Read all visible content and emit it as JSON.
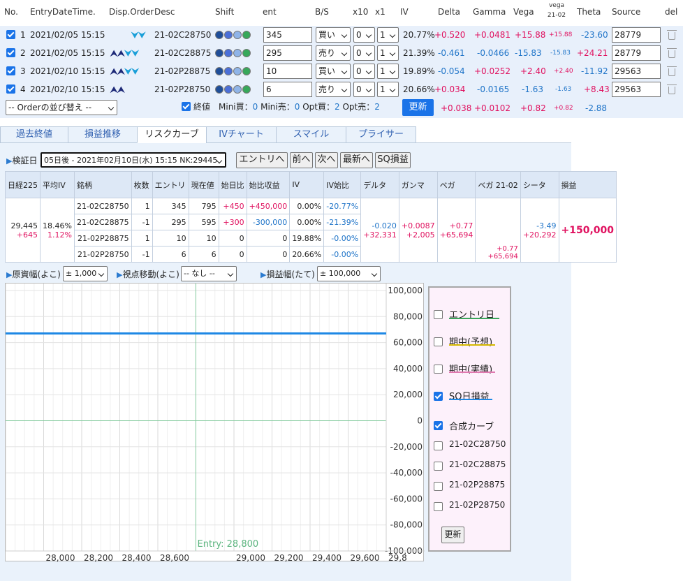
{
  "order_table": {
    "headers": {
      "no": "No.",
      "entry": "EntryDateTime.",
      "disp": "Disp.Order",
      "desc": "Desc",
      "shift": "Shift",
      "ent": "ent",
      "bs": "B/S",
      "x10": "x10",
      "x1": "x1",
      "iv": "IV",
      "delta": "Delta",
      "gamma": "Gamma",
      "vega": "Vega",
      "vega2_top": "vega",
      "vega2_bot": "21-02",
      "theta": "Theta",
      "source": "Source",
      "del": "del"
    },
    "rows": [
      {
        "no": "1",
        "datetime": "2021/02/05 15:15",
        "arrows": "⮟⮟",
        "desc": "21-02C28750",
        "ent": "345",
        "bs": "買い",
        "x10": "0",
        "x1": "1",
        "iv": "20.77%",
        "delta": "+0.520",
        "gamma": "+0.0481",
        "vega": "+15.88",
        "vega2": "+15.88",
        "theta": "-23.60",
        "source": "28779"
      },
      {
        "no": "2",
        "datetime": "2021/02/05 15:15",
        "arrows": "⮝⮝⮟⮟",
        "desc": "21-02C28875",
        "ent": "295",
        "bs": "売り",
        "x10": "0",
        "x1": "1",
        "iv": "21.39%",
        "delta": "-0.461",
        "gamma": "-0.0466",
        "vega": "-15.83",
        "vega2": "-15.83",
        "theta": "+24.21",
        "source": "28779"
      },
      {
        "no": "3",
        "datetime": "2021/02/10 15:15",
        "arrows": "⮝⮝⮟⮟",
        "desc": "21-02P28875",
        "ent": "10",
        "bs": "買い",
        "x10": "0",
        "x1": "1",
        "iv": "19.89%",
        "delta": "-0.054",
        "gamma": "+0.0252",
        "vega": "+2.40",
        "vega2": "+2.40",
        "theta": "-11.92",
        "source": "29563"
      },
      {
        "no": "4",
        "datetime": "2021/02/10 15:15",
        "arrows": "⮝⮝",
        "desc": "21-02P28750",
        "ent": "6",
        "bs": "売り",
        "x10": "0",
        "x1": "1",
        "iv": "20.66%",
        "delta": "+0.034",
        "gamma": "-0.0165",
        "vega": "-1.63",
        "vega2": "-1.63",
        "theta": "+8.43",
        "source": "29563"
      }
    ],
    "footer": {
      "sort_select": "-- Orderの並び替え --",
      "final_label": "終値",
      "mini_buy_label": "Mini買：",
      "mini_buy": "0",
      "mini_sell_label": "Mini売：",
      "mini_sell": "0",
      "opt_buy_label": "Opt買：",
      "opt_buy": "2",
      "opt_sell_label": "Opt売：",
      "opt_sell": "2",
      "update_button": "更新",
      "delta": "+0.038",
      "gamma": "+0.0102",
      "vega": "+0.82",
      "vega2": "+0.82",
      "theta": "-2.88"
    }
  },
  "tabs": [
    "過去終値",
    "損益推移",
    "リスクカーブ",
    "IVチャート",
    "スマイル",
    "プライサー"
  ],
  "active_tab": "リスクカーブ",
  "verify": {
    "label": "検証日",
    "date_select": "05日後 - 2021年02月10日(水) 15:15 NK:29445",
    "buttons": [
      "エントリへ",
      "前へ",
      "次へ",
      "最新へ",
      "SQ損益"
    ]
  },
  "risk_table": {
    "headers": [
      "日経225",
      "平均IV",
      "銘柄",
      "枚数",
      "エントリ",
      "現在値",
      "始日比",
      "始比収益",
      "IV",
      "IV始比",
      "デルタ",
      "ガンマ",
      "ベガ",
      "ベガ 21-02",
      "シータ",
      "損益"
    ],
    "nikkei": "29,445",
    "nikkei_chg": "+645",
    "avg_iv": "18.46%",
    "avg_iv_chg": "1.12%",
    "rows": [
      {
        "name": "21-02C28750",
        "qty": "1",
        "entry": "345",
        "cur": "795",
        "chg": "+450",
        "pl": "+450,000",
        "iv": "0.00%",
        "ivchg": "-20.77%"
      },
      {
        "name": "21-02C28875",
        "qty": "-1",
        "entry": "295",
        "cur": "595",
        "chg": "+300",
        "pl": "-300,000",
        "iv": "0.00%",
        "ivchg": "-21.39%"
      },
      {
        "name": "21-02P28875",
        "qty": "1",
        "entry": "10",
        "cur": "10",
        "chg": "0",
        "pl": "0",
        "iv": "19.88%",
        "ivchg": "-0.00%"
      },
      {
        "name": "21-02P28750",
        "qty": "-1",
        "entry": "6",
        "cur": "6",
        "chg": "0",
        "pl": "0",
        "iv": "20.66%",
        "ivchg": "-0.00%"
      }
    ],
    "delta": "-0.020",
    "delta2": "+32,331",
    "gamma": "+0.0087",
    "gamma2": "+2,005",
    "vega": "+0.77",
    "vega2": "+65,694",
    "vega21": "+0.77",
    "vega21b": "+65,694",
    "theta": "-3.49",
    "theta2": "+20,292",
    "pl_total": "+150,000"
  },
  "controls": {
    "xrange_label": "原資幅(よこ)",
    "xrange": "± 1,000",
    "view_label": "視点移動(よこ)",
    "view": "-- なし --",
    "yrange_label": "損益幅(たて)",
    "yrange": "± 100,000"
  },
  "chart_data": {
    "type": "line",
    "x_ticks": [
      "28,000",
      "28,200",
      "28,400",
      "28,600",
      "29,000",
      "29,200",
      "29,400",
      "29,600",
      "29,8"
    ],
    "y_ticks": [
      "100,000",
      "80,000",
      "60,000",
      "40,000",
      "20,000",
      "0",
      "-20,000",
      "-40,000",
      "-60,000",
      "-80,000",
      "-100,000"
    ],
    "ylim": [
      -100000,
      100000
    ],
    "xlim": [
      27800,
      29800
    ],
    "entry_label": "Entry: 28,800",
    "entry_x": 28800,
    "series": [
      {
        "name": "SQ日損益",
        "color": "#1e88e5",
        "x": [
          27800,
          29800
        ],
        "y": [
          67000,
          67000
        ]
      }
    ]
  },
  "legend": {
    "items": [
      {
        "label": "エントリ日",
        "checked": false,
        "color": "#3aa55b"
      },
      {
        "label": "期中(予想)",
        "checked": false,
        "color": "#d4b800"
      },
      {
        "label": "期中(実績)",
        "checked": false,
        "color": "#e07ab0"
      },
      {
        "label": "SQ日損益",
        "checked": true,
        "color": "#1e88e5"
      },
      {
        "label": "合成カーブ",
        "checked": true,
        "color": ""
      },
      {
        "label": "21-02C28750",
        "checked": false,
        "color": ""
      },
      {
        "label": "21-02C28875",
        "checked": false,
        "color": ""
      },
      {
        "label": "21-02P28875",
        "checked": false,
        "color": ""
      },
      {
        "label": "21-02P28750",
        "checked": false,
        "color": ""
      }
    ],
    "update_button": "更新"
  }
}
